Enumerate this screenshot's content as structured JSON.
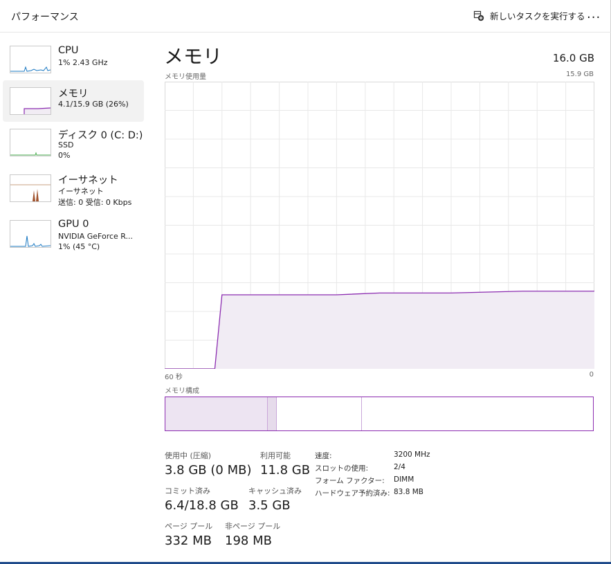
{
  "header": {
    "title": "パフォーマンス",
    "run_task_label": "新しいタスクを実行する",
    "more_label": "..."
  },
  "sidebar": {
    "items": [
      {
        "name": "CPU",
        "line1": "1%  2.43 GHz",
        "line2": ""
      },
      {
        "name": "メモリ",
        "line1": "4.1/15.9 GB (26%)",
        "line2": ""
      },
      {
        "name": "ディスク 0 (C: D:)",
        "line1": "SSD",
        "line2": "0%"
      },
      {
        "name": "イーサネット",
        "line1": "イーサネット",
        "line2": "送信: 0 受信: 0 Kbps"
      },
      {
        "name": "GPU 0",
        "line1": "NVIDIA GeForce R...",
        "line2": "1%  (45 °C)"
      }
    ]
  },
  "main": {
    "title": "メモリ",
    "total": "16.0 GB",
    "usage_label": "メモリ使用量",
    "usage_max": "15.9 GB",
    "time_start": "60 秒",
    "time_end": "0",
    "composition_label": "メモリ構成"
  },
  "chart_data": {
    "type": "area",
    "title": "メモリ使用量",
    "x": [
      60,
      53,
      52,
      47,
      36,
      30,
      20,
      10,
      0
    ],
    "y": [
      0,
      0,
      4.1,
      4.1,
      4.1,
      4.2,
      4.2,
      4.3,
      4.3
    ],
    "xlabel": "",
    "ylabel": "",
    "xlim": [
      60,
      0
    ],
    "ylim": [
      0,
      15.9
    ],
    "grid": true,
    "composition": {
      "in_use_pct": 24,
      "modified_pct": 2,
      "standby_pct": 20,
      "free_pct": 54
    }
  },
  "stats": {
    "in_use_label": "使用中 (圧縮)",
    "in_use_value": "3.8 GB (0 MB)",
    "available_label": "利用可能",
    "available_value": "11.8 GB",
    "committed_label": "コミット済み",
    "committed_value": "6.4/18.8 GB",
    "cached_label": "キャッシュ済み",
    "cached_value": "3.5 GB",
    "paged_label": "ページ プール",
    "paged_value": "332 MB",
    "nonpaged_label": "非ページ プール",
    "nonpaged_value": "198 MB"
  },
  "details": [
    {
      "label": "速度:",
      "value": "3200 MHz"
    },
    {
      "label": "スロットの使用:",
      "value": "2/4"
    },
    {
      "label": "フォーム ファクター:",
      "value": "DIMM"
    },
    {
      "label": "ハードウェア予約済み:",
      "value": "83.8 MB"
    }
  ],
  "colors": {
    "accent": "#8b2bb0",
    "fill": "#f1ecf4",
    "cpu": "#1a78c2",
    "disk": "#4caf50",
    "net": "#a0522d"
  }
}
